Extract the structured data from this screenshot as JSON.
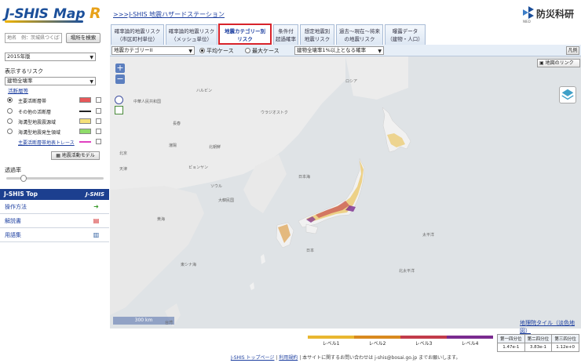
{
  "header": {
    "logo_text": "J-SHIS",
    "logo_map": "Map",
    "logo_r": "R",
    "station_link": ">>>J-SHIS 地震ハザードステーション",
    "org_name": "防災科研",
    "org_sub": "NIED"
  },
  "search": {
    "placeholder": "地名　例：茨城県つくば市",
    "button": "場所を検索"
  },
  "tabs": [
    {
      "line1": "確率論的地震リスク",
      "line2": "（市区町村単位）"
    },
    {
      "line1": "確率論的地震リスク",
      "line2": "（メッシュ単位）"
    },
    {
      "line1": "地震カテゴリー別",
      "line2": "リスク"
    },
    {
      "line1": "条件付",
      "line2": "超過確率"
    },
    {
      "line1": "想定地震別",
      "line2": "地震リスク"
    },
    {
      "line1": "過去～現在～将来",
      "line2": "の地震リスク"
    },
    {
      "line1": "曝露データ",
      "line2": "（建物・人口）"
    }
  ],
  "toolbar": {
    "category_select": "地震カテゴリーII",
    "radio_average": "平均ケース",
    "radio_max": "最大ケース",
    "prob_select": "建物全壊率1%以上となる確率",
    "legend_button": "凡例"
  },
  "left": {
    "year_select": "2015年版",
    "risk_label": "表示するリスク",
    "risk_select": "建物全壊率",
    "faults_label": "活断層等",
    "layers": [
      {
        "name": "主要活断層帯",
        "color": "#e8585a"
      },
      {
        "name": "その他の活断層",
        "color": "#222222"
      },
      {
        "name": "海溝型地震震源域",
        "color": "#f5e07a"
      },
      {
        "name": "海溝型地震発生領域",
        "color": "#8fdc6a"
      },
      {
        "name": "主要活断層帯地表トレース",
        "color": "#e040c0"
      }
    ],
    "activity_button": "地震活動モデル",
    "opacity_label": "透過率",
    "opacity_value": 0.18
  },
  "menu": {
    "top_title": "J-SHIS Top",
    "top_logo": "J-SHIS",
    "items": [
      "操作方法",
      "解説書",
      "用語集"
    ]
  },
  "map": {
    "zoom_in": "+",
    "zoom_out": "−",
    "link_button": "地図のリンク",
    "scale": "300 km",
    "places": [
      "中華人民共和国",
      "ハルビン",
      "ロシア",
      "ウラジオストク",
      "長春",
      "瀋陽",
      "北朝鮮",
      "ピョンヤン",
      "ソウル",
      "大韓民国",
      "北京",
      "天津",
      "黄海",
      "東シナ海",
      "日本",
      "日本海",
      "台湾",
      "太平洋",
      "北太平洋"
    ]
  },
  "bottom": {
    "tile_link": "地理院タイル（淡色地図）",
    "levels": [
      "レベル1",
      "レベル2",
      "レベル3",
      "レベル4"
    ],
    "level_colors": [
      "#e9b730",
      "#d98a1f",
      "#c23b4a",
      "#7a2a8f"
    ],
    "stats_headers": [
      "第一四分位",
      "第二四分位",
      "第三四分位"
    ],
    "stats_values": [
      "1.47e-1",
      "3.83e-1",
      "1.12e+0"
    ],
    "footer_top": "J-SHIS トップページ",
    "footer_terms": "利用規約",
    "footer_msg": "本サイトに関するお問い合わせは j-shis@bosai.go.jp までお願いします。"
  }
}
